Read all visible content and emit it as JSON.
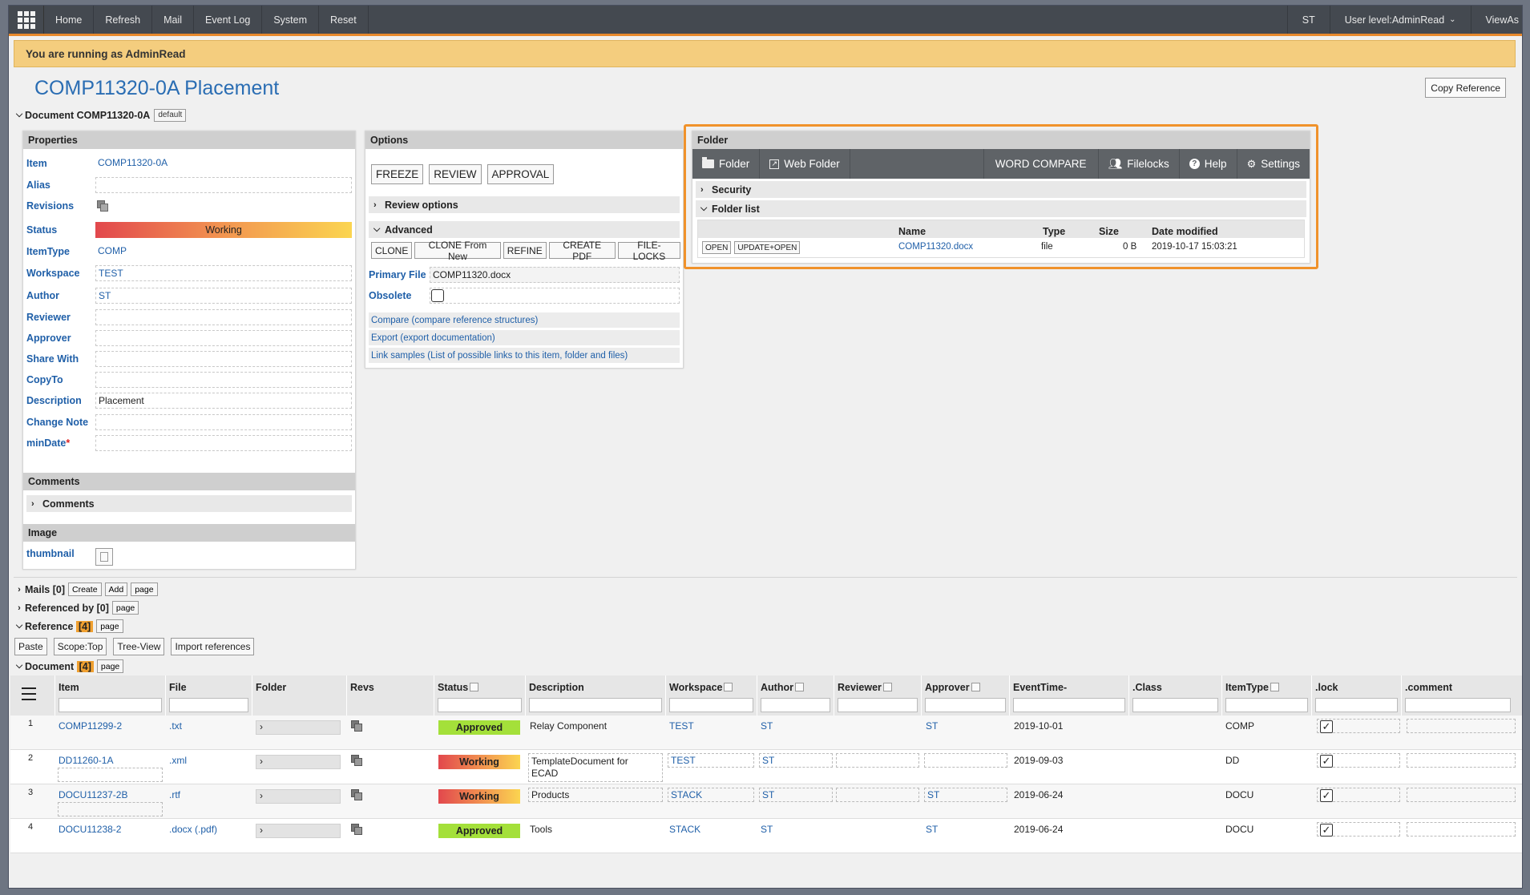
{
  "topbar": {
    "nav": [
      "Home",
      "Refresh",
      "Mail",
      "Event Log",
      "System",
      "Reset"
    ],
    "user": "ST",
    "user_level": "User level:AdminRead",
    "view_as": "ViewAs"
  },
  "banner": {
    "text": "You are running as AdminRead"
  },
  "page": {
    "title": "COMP11320-0A Placement",
    "copy_reference": "Copy Reference"
  },
  "document_section": {
    "title": "Document COMP11320-0A",
    "tag": "default"
  },
  "properties": {
    "title": "Properties",
    "rows": [
      {
        "label": "Item",
        "value": "COMP11320-0A"
      },
      {
        "label": "Alias",
        "value": ""
      },
      {
        "label": "Revisions",
        "value": ""
      },
      {
        "label": "Status",
        "value": "Working"
      },
      {
        "label": "ItemType",
        "value": "COMP"
      },
      {
        "label": "Workspace",
        "value": "TEST"
      },
      {
        "label": "Author",
        "value": "ST"
      },
      {
        "label": "Reviewer",
        "value": ""
      },
      {
        "label": "Approver",
        "value": ""
      },
      {
        "label": "Share With",
        "value": ""
      },
      {
        "label": "CopyTo",
        "value": ""
      },
      {
        "label": "Description",
        "value": "Placement"
      },
      {
        "label": "Change Note",
        "value": ""
      },
      {
        "label": "minDate",
        "value": "",
        "required": "*"
      }
    ],
    "comments_title": "Comments",
    "comments_sub": "Comments",
    "image_title": "Image",
    "thumbnail_label": "thumbnail"
  },
  "options": {
    "title": "Options",
    "workflow_buttons": [
      "FREEZE",
      "REVIEW",
      "APPROVAL"
    ],
    "review_options": "Review options",
    "advanced": "Advanced",
    "advanced_buttons": [
      "CLONE",
      "CLONE From New",
      "REFINE",
      "CREATE PDF",
      "FILE-LOCKS"
    ],
    "primary_file_label": "Primary File",
    "primary_file_value": "COMP11320.docx",
    "obsolete_label": "Obsolete",
    "links": [
      "Compare (compare reference structures)",
      "Export (export documentation)",
      "Link samples (List of possible links to this item, folder and files)"
    ]
  },
  "folder": {
    "title": "Folder",
    "toolbar": {
      "folder": "Folder",
      "web_folder": "Web Folder",
      "word_compare": "WORD COMPARE",
      "filelocks": "Filelocks",
      "help": "Help",
      "settings": "Settings"
    },
    "security": "Security",
    "folder_list": "Folder list",
    "columns": [
      "Name",
      "Type",
      "Size",
      "Date modified"
    ],
    "files": [
      {
        "open": "OPEN",
        "update": "UPDATE+OPEN",
        "name": "COMP11320.docx",
        "type": "file",
        "size": "0 B",
        "modified": "2019-10-17 15:03:21"
      }
    ]
  },
  "sections": {
    "mails": "Mails [0]",
    "mails_buttons": [
      "Create",
      "Add",
      "page"
    ],
    "referenced_by": "Referenced by [0]",
    "referenced_by_buttons": [
      "page"
    ],
    "reference": "Reference",
    "reference_count": "[4]",
    "reference_page": "page",
    "reference_buttons": [
      "Paste",
      "Scope:Top",
      "Tree-View",
      "Import references"
    ],
    "document": "Document",
    "document_count": "[4]",
    "document_page": "page"
  },
  "doc_table": {
    "columns": [
      "Item",
      "File",
      "Folder",
      "Revs",
      "Status",
      "Description",
      "Workspace",
      "Author",
      "Reviewer",
      "Approver",
      "EventTime-",
      ".Class",
      "ItemType",
      ".lock",
      ".comment"
    ],
    "rows": [
      {
        "n": "1",
        "item": "COMP11299-2",
        "file": ".txt",
        "status": "Approved",
        "description": "Relay Component",
        "description2": "",
        "workspace": "TEST",
        "author": "ST",
        "reviewer": "",
        "approver": "ST",
        "event": "2019-10-01",
        "itemtype": "COMP"
      },
      {
        "n": "2",
        "item": "DD11260-1A",
        "file": ".xml",
        "status": "Working",
        "description": "TemplateDocument for",
        "description2": "ECAD",
        "workspace": "TEST",
        "author": "ST",
        "reviewer": "",
        "approver": "",
        "event": "2019-09-03",
        "itemtype": "DD"
      },
      {
        "n": "3",
        "item": "DOCU11237-2B",
        "file": ".rtf",
        "status": "Working",
        "description": "Products",
        "description2": "",
        "workspace": "STACK",
        "author": "ST",
        "reviewer": "",
        "approver": "ST",
        "event": "2019-06-24",
        "itemtype": "DOCU"
      },
      {
        "n": "4",
        "item": "DOCU11238-2",
        "file": ".docx (.pdf)",
        "status": "Approved",
        "description": "Tools",
        "description2": "",
        "workspace": "STACK",
        "author": "ST",
        "reviewer": "",
        "approver": "ST",
        "event": "2019-06-24",
        "itemtype": "DOCU"
      }
    ]
  },
  "colors": {
    "accent": "#e7892c",
    "link": "#1f5fa8",
    "approved": "#a4e03a",
    "banner": "#f4cd7e",
    "topbar": "#444950"
  }
}
